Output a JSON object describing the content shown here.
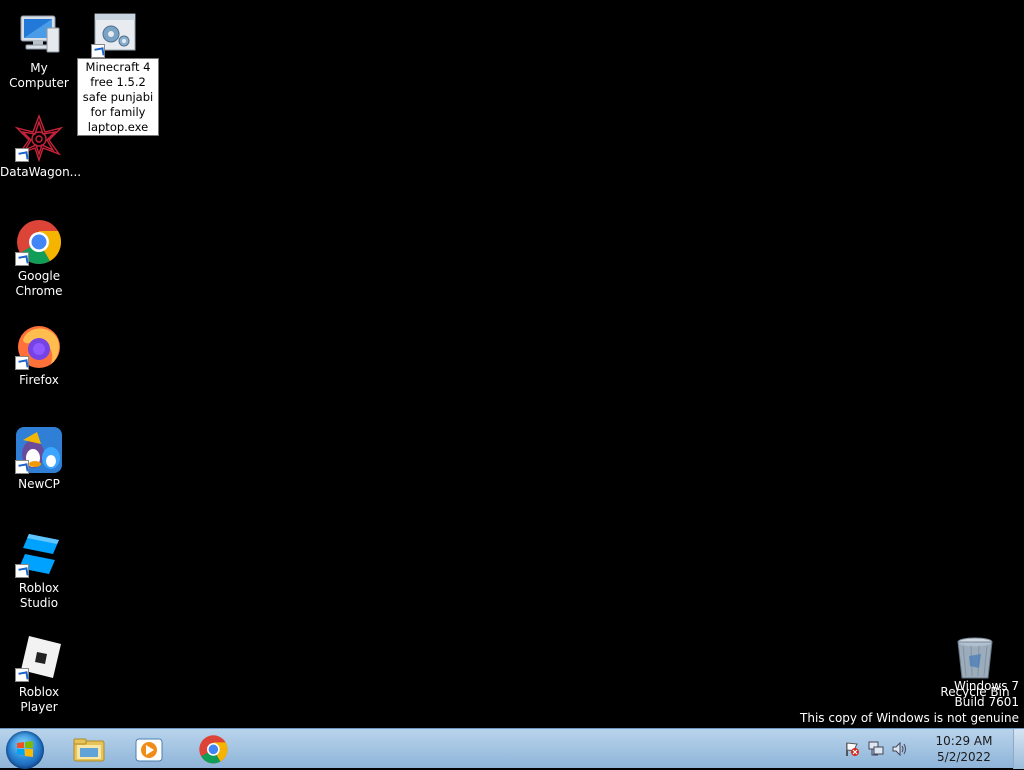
{
  "desktop_icons": [
    {
      "label": "My Computer",
      "icon": "computer-icon"
    },
    {
      "label": "DataWagon...",
      "icon": "datawagon-icon"
    },
    {
      "label": "Google Chrome",
      "icon": "chrome-icon"
    },
    {
      "label": "Firefox",
      "icon": "firefox-icon"
    },
    {
      "label": "NewCP",
      "icon": "newcp-icon"
    },
    {
      "label": "Roblox Studio",
      "icon": "roblox-studio-icon"
    },
    {
      "label": "Roblox Player",
      "icon": "roblox-player-icon"
    },
    {
      "label": "Recycle Bin",
      "icon": "recycle-bin-icon"
    }
  ],
  "rename": {
    "value": "Minecraft 4 free 1.5.2 safe punjabi for family laptop.exe",
    "icon": "installer-icon"
  },
  "watermark": {
    "line1": "Windows 7",
    "line2": "Build 7601",
    "line3": "This copy of Windows is not genuine"
  },
  "taskbar": {
    "pinned": [
      "explorer-icon",
      "media-player-icon",
      "chrome-icon"
    ],
    "tray_icons": [
      "action-center-icon",
      "network-icon",
      "volume-icon"
    ],
    "time": "10:29 AM",
    "date": "5/2/2022"
  },
  "colors": {
    "desktop": "#000000",
    "taskbar": "#a9c7e5"
  }
}
